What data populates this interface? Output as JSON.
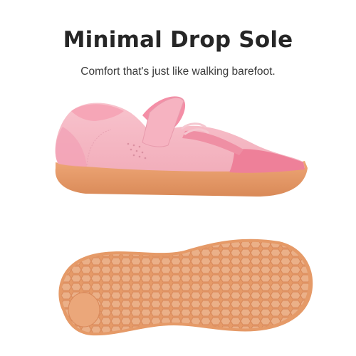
{
  "headline": "Minimal Drop Sole",
  "tagline": "Comfort that's just like walking barefoot.",
  "colors": {
    "upper_light": "#f4b6c2",
    "upper_mid": "#f59aae",
    "suede": "#f07d95",
    "sole_gum": "#e8a070",
    "sole_light": "#f2b184",
    "sole_dark": "#d88a5a",
    "text": "#262626"
  },
  "icons": {
    "side_view": "shoe-side-view",
    "bottom_view": "shoe-sole-view"
  }
}
